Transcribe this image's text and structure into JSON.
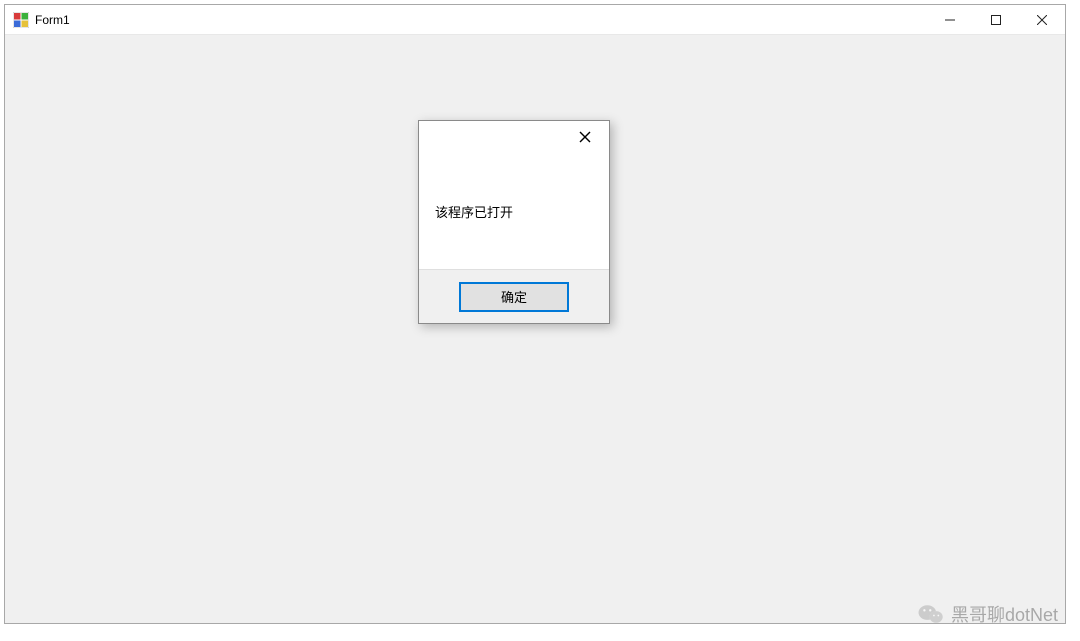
{
  "window": {
    "title": "Form1"
  },
  "dialog": {
    "message": "该程序已打开",
    "ok_label": "确定"
  },
  "watermark": {
    "text": "黑哥聊dotNet"
  }
}
